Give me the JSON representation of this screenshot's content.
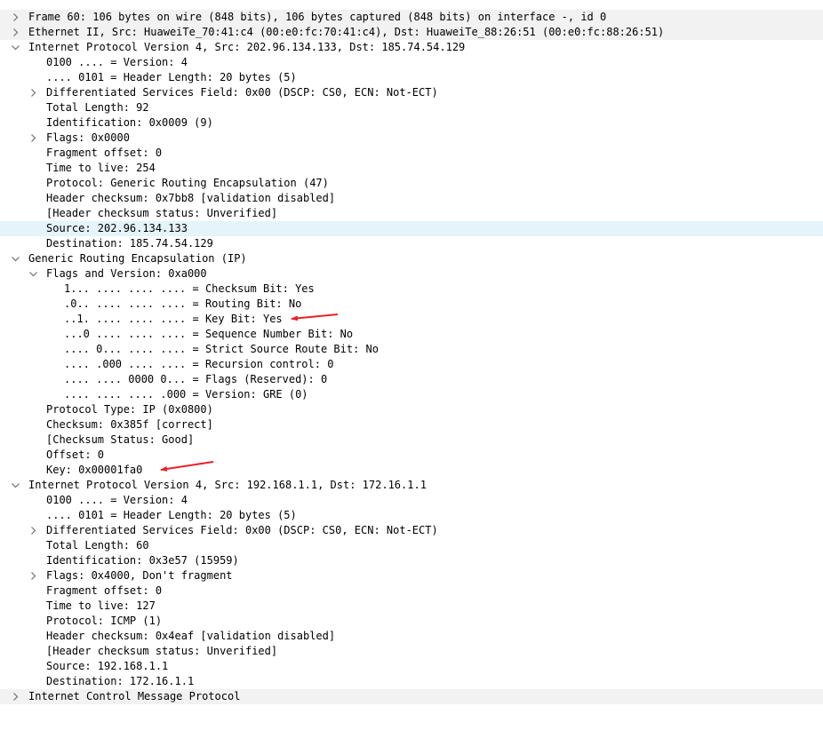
{
  "tree": [
    {
      "text": "Frame 60: 106 bytes on wire (848 bits), 106 bytes captured (848 bits) on interface -, id 0",
      "level": 0,
      "toggle": "collapsed"
    },
    {
      "text": "Ethernet II, Src: HuaweiTe_70:41:c4 (00:e0:fc:70:41:c4), Dst: HuaweiTe_88:26:51 (00:e0:fc:88:26:51)",
      "level": 0,
      "toggle": "collapsed"
    },
    {
      "text": "Internet Protocol Version 4, Src: 202.96.134.133, Dst: 185.74.54.129",
      "level": 0,
      "toggle": "expanded"
    },
    {
      "text": "0100 .... = Version: 4",
      "level": 1,
      "toggle": "none"
    },
    {
      "text": ".... 0101 = Header Length: 20 bytes (5)",
      "level": 1,
      "toggle": "none"
    },
    {
      "text": "Differentiated Services Field: 0x00 (DSCP: CS0, ECN: Not-ECT)",
      "level": 1,
      "toggle": "collapsed"
    },
    {
      "text": "Total Length: 92",
      "level": 1,
      "toggle": "none"
    },
    {
      "text": "Identification: 0x0009 (9)",
      "level": 1,
      "toggle": "none"
    },
    {
      "text": "Flags: 0x0000",
      "level": 1,
      "toggle": "collapsed"
    },
    {
      "text": "Fragment offset: 0",
      "level": 1,
      "toggle": "none"
    },
    {
      "text": "Time to live: 254",
      "level": 1,
      "toggle": "none"
    },
    {
      "text": "Protocol: Generic Routing Encapsulation (47)",
      "level": 1,
      "toggle": "none"
    },
    {
      "text": "Header checksum: 0x7bb8 [validation disabled]",
      "level": 1,
      "toggle": "none"
    },
    {
      "text": "[Header checksum status: Unverified]",
      "level": 1,
      "toggle": "none"
    },
    {
      "text": "Source: 202.96.134.133",
      "level": 1,
      "toggle": "none",
      "selected": true
    },
    {
      "text": "Destination: 185.74.54.129",
      "level": 1,
      "toggle": "none"
    },
    {
      "text": "Generic Routing Encapsulation (IP)",
      "level": 0,
      "toggle": "expanded"
    },
    {
      "text": "Flags and Version: 0xa000",
      "level": 1,
      "toggle": "expanded"
    },
    {
      "text": "1... .... .... .... = Checksum Bit: Yes",
      "level": 2,
      "toggle": "none"
    },
    {
      "text": ".0.. .... .... .... = Routing Bit: No",
      "level": 2,
      "toggle": "none"
    },
    {
      "text": "..1. .... .... .... = Key Bit: Yes",
      "level": 2,
      "toggle": "none",
      "annotated": true
    },
    {
      "text": "...0 .... .... .... = Sequence Number Bit: No",
      "level": 2,
      "toggle": "none"
    },
    {
      "text": ".... 0... .... .... = Strict Source Route Bit: No",
      "level": 2,
      "toggle": "none"
    },
    {
      "text": ".... .000 .... .... = Recursion control: 0",
      "level": 2,
      "toggle": "none"
    },
    {
      "text": ".... .... 0000 0... = Flags (Reserved): 0",
      "level": 2,
      "toggle": "none"
    },
    {
      "text": ".... .... .... .000 = Version: GRE (0)",
      "level": 2,
      "toggle": "none"
    },
    {
      "text": "Protocol Type: IP (0x0800)",
      "level": 1,
      "toggle": "none"
    },
    {
      "text": "Checksum: 0x385f [correct]",
      "level": 1,
      "toggle": "none"
    },
    {
      "text": "[Checksum Status: Good]",
      "level": 1,
      "toggle": "none"
    },
    {
      "text": "Offset: 0",
      "level": 1,
      "toggle": "none"
    },
    {
      "text": "Key: 0x00001fa0",
      "level": 1,
      "toggle": "none",
      "annotated": true
    },
    {
      "text": "Internet Protocol Version 4, Src: 192.168.1.1, Dst: 172.16.1.1",
      "level": 0,
      "toggle": "expanded"
    },
    {
      "text": "0100 .... = Version: 4",
      "level": 1,
      "toggle": "none"
    },
    {
      "text": ".... 0101 = Header Length: 20 bytes (5)",
      "level": 1,
      "toggle": "none"
    },
    {
      "text": "Differentiated Services Field: 0x00 (DSCP: CS0, ECN: Not-ECT)",
      "level": 1,
      "toggle": "collapsed"
    },
    {
      "text": "Total Length: 60",
      "level": 1,
      "toggle": "none"
    },
    {
      "text": "Identification: 0x3e57 (15959)",
      "level": 1,
      "toggle": "none"
    },
    {
      "text": "Flags: 0x4000, Don't fragment",
      "level": 1,
      "toggle": "collapsed"
    },
    {
      "text": "Fragment offset: 0",
      "level": 1,
      "toggle": "none"
    },
    {
      "text": "Time to live: 127",
      "level": 1,
      "toggle": "none"
    },
    {
      "text": "Protocol: ICMP (1)",
      "level": 1,
      "toggle": "none"
    },
    {
      "text": "Header checksum: 0x4eaf [validation disabled]",
      "level": 1,
      "toggle": "none"
    },
    {
      "text": "[Header checksum status: Unverified]",
      "level": 1,
      "toggle": "none"
    },
    {
      "text": "Source: 192.168.1.1",
      "level": 1,
      "toggle": "none"
    },
    {
      "text": "Destination: 172.16.1.1",
      "level": 1,
      "toggle": "none"
    },
    {
      "text": "Internet Control Message Protocol",
      "level": 0,
      "toggle": "collapsed"
    }
  ],
  "colors": {
    "background": "#ffffff",
    "alternate_row": "#f2f2f2",
    "selected_row": "#e5f3fb",
    "toggle_arrow": "#6e6e6e",
    "annotation_arrow": "#e8222a"
  }
}
